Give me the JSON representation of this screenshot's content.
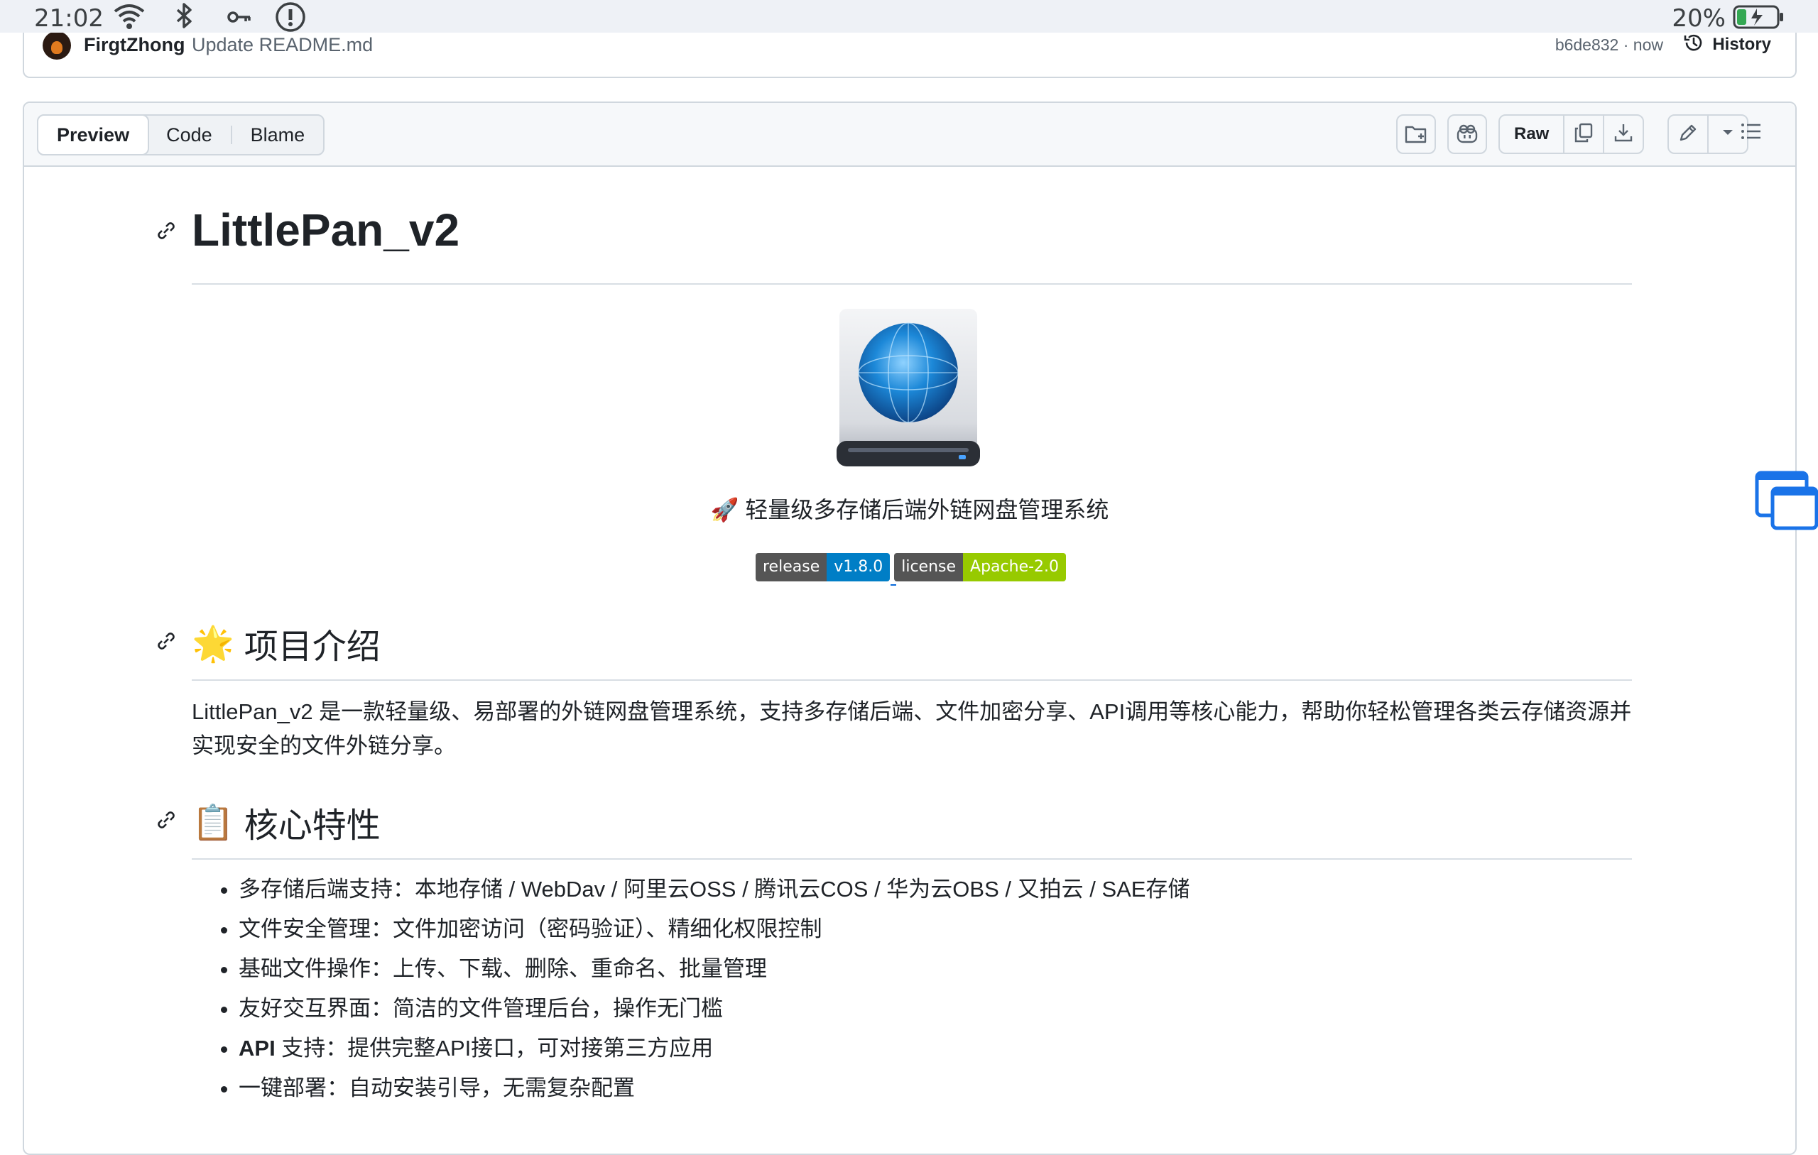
{
  "status_bar": {
    "time": "21:02",
    "battery": "20%"
  },
  "commit": {
    "author": "FirgtZhong",
    "message": "Update README.md",
    "sha_time": "b6de832 · now",
    "history_label": "History"
  },
  "toolbar": {
    "tabs": [
      "Preview",
      "Code",
      "Blame"
    ],
    "raw_label": "Raw"
  },
  "readme": {
    "title": "LittlePan_v2",
    "tagline": "🚀 轻量级多存储后端外链网盘管理系统",
    "badges": [
      {
        "label": "release",
        "value": "v1.8.0",
        "color": "#007ec6"
      },
      {
        "label": "license",
        "value": "Apache-2.0",
        "color": "#97ca00"
      }
    ],
    "intro_heading": "项目介绍",
    "intro_emoji": "🌟",
    "intro_text": "LittlePan_v2 是一款轻量级、易部署的外链网盘管理系统，支持多存储后端、文件加密分享、API调用等核心能力，帮助你轻松管理各类云存储资源并实现安全的文件外链分享。",
    "features_heading": "核心特性",
    "features_emoji": "📋",
    "features": [
      {
        "bold": "",
        "text": "多存储后端支持：本地存储 / WebDav / 阿里云OSS / 腾讯云COS / 华为云OBS / 又拍云 / SAE存储"
      },
      {
        "bold": "",
        "text": "文件安全管理：文件加密访问（密码验证）、精细化权限控制"
      },
      {
        "bold": "",
        "text": "基础文件操作：上传、下载、删除、重命名、批量管理"
      },
      {
        "bold": "",
        "text": "友好交互界面：简洁的文件管理后台，操作无门槛"
      },
      {
        "bold": "API",
        "text": " 支持：提供完整API接口，可对接第三方应用"
      },
      {
        "bold": "",
        "text": "一键部署：自动安装引导，无需复杂配置"
      }
    ]
  }
}
